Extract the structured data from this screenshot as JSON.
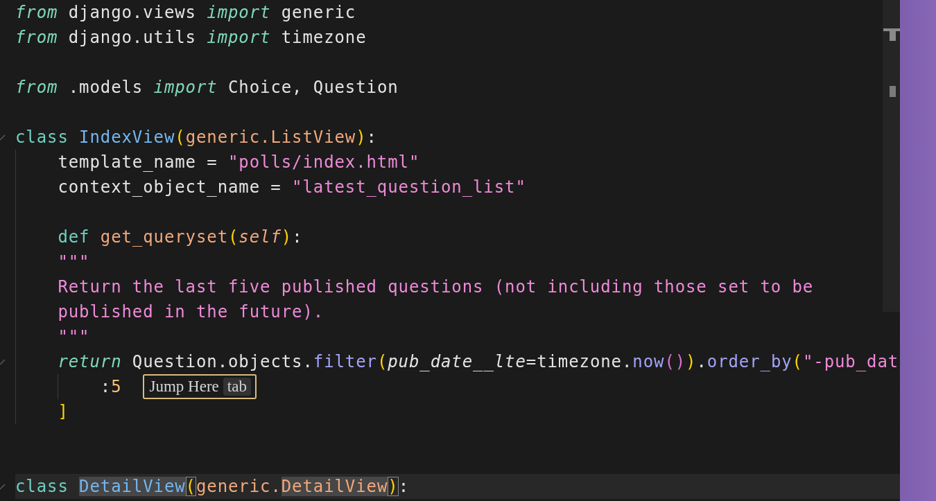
{
  "editor": {
    "lines": [
      {
        "kind": "code",
        "foldable": false,
        "current": false,
        "tokens": [
          {
            "text": "from",
            "kind": "control"
          },
          {
            "text": " django.views ",
            "kind": "plain"
          },
          {
            "text": "import",
            "kind": "control"
          },
          {
            "text": " generic",
            "kind": "plain"
          }
        ]
      },
      {
        "kind": "code",
        "foldable": false,
        "current": false,
        "tokens": [
          {
            "text": "from",
            "kind": "control"
          },
          {
            "text": " django.utils ",
            "kind": "plain"
          },
          {
            "text": "import",
            "kind": "control"
          },
          {
            "text": " timezone",
            "kind": "plain"
          }
        ]
      },
      {
        "kind": "blank"
      },
      {
        "kind": "code",
        "foldable": false,
        "current": false,
        "tokens": [
          {
            "text": "from",
            "kind": "control"
          },
          {
            "text": " .models ",
            "kind": "plain"
          },
          {
            "text": "import",
            "kind": "control"
          },
          {
            "text": " Choice, Question",
            "kind": "plain"
          }
        ]
      },
      {
        "kind": "blank"
      },
      {
        "kind": "code",
        "foldable": true,
        "current": false,
        "tokens": [
          {
            "text": "class ",
            "kind": "keyword"
          },
          {
            "text": "IndexView",
            "kind": "class"
          },
          {
            "text": "(",
            "kind": "bracket"
          },
          {
            "text": "generic.ListView",
            "kind": "base"
          },
          {
            "text": ")",
            "kind": "bracket"
          },
          {
            "text": ":",
            "kind": "plain"
          }
        ],
        "children": [
          {
            "kind": "code",
            "foldable": false,
            "current": false,
            "tokens": [
              {
                "text": "template_name = ",
                "kind": "plain"
              },
              {
                "text": "\"polls/index.html\"",
                "kind": "string"
              }
            ]
          },
          {
            "kind": "code",
            "foldable": false,
            "current": false,
            "tokens": [
              {
                "text": "context_object_name = ",
                "kind": "plain"
              },
              {
                "text": "\"latest_question_list\"",
                "kind": "string"
              }
            ]
          },
          {
            "kind": "blank"
          },
          {
            "kind": "code",
            "foldable": false,
            "current": false,
            "tokens": [
              {
                "text": "def ",
                "kind": "keyword"
              },
              {
                "text": "get_queryset",
                "kind": "base"
              },
              {
                "text": "(",
                "kind": "bracket"
              },
              {
                "text": "self",
                "kind": "param"
              },
              {
                "text": ")",
                "kind": "bracket"
              },
              {
                "text": ":",
                "kind": "plain"
              }
            ]
          },
          {
            "kind": "code",
            "foldable": false,
            "current": false,
            "tokens": [
              {
                "text": "\"\"\"",
                "kind": "string"
              }
            ]
          },
          {
            "kind": "code",
            "foldable": false,
            "current": false,
            "tokens": [
              {
                "text": "Return the last five published questions (not including those set to be",
                "kind": "string"
              }
            ]
          },
          {
            "kind": "code",
            "foldable": false,
            "current": false,
            "tokens": [
              {
                "text": "published in the future).",
                "kind": "string"
              }
            ]
          },
          {
            "kind": "code",
            "foldable": false,
            "current": false,
            "tokens": [
              {
                "text": "\"\"\"",
                "kind": "string"
              }
            ]
          },
          {
            "kind": "code",
            "foldable": true,
            "current": false,
            "tokens": [
              {
                "text": "return",
                "kind": "control"
              },
              {
                "text": " Question.objects.",
                "kind": "plain"
              },
              {
                "text": "filter",
                "kind": "method"
              },
              {
                "text": "(",
                "kind": "bracket"
              },
              {
                "text": "pub_date__lte",
                "kind": "argument"
              },
              {
                "text": "=timezone.",
                "kind": "plain"
              },
              {
                "text": "now",
                "kind": "method"
              },
              {
                "text": "()",
                "kind": "bracket2"
              },
              {
                "text": ")",
                "kind": "bracket"
              },
              {
                "text": ".",
                "kind": "plain"
              },
              {
                "text": "order_by",
                "kind": "method"
              },
              {
                "text": "(",
                "kind": "bracket"
              },
              {
                "text": "\"-pub_dat",
                "kind": "string"
              }
            ],
            "children": [
              {
                "kind": "code",
                "foldable": false,
                "current": false,
                "tokens": [
                  {
                    "text": ":",
                    "kind": "plain"
                  },
                  {
                    "text": "5",
                    "kind": "number"
                  }
                ],
                "hint": {
                  "label": "Jump Here",
                  "key": "tab"
                }
              }
            ]
          },
          {
            "kind": "code",
            "foldable": false,
            "current": false,
            "tokens": [
              {
                "text": "]",
                "kind": "bracket"
              }
            ]
          }
        ]
      },
      {
        "kind": "blank"
      },
      {
        "kind": "blank"
      },
      {
        "kind": "code",
        "foldable": true,
        "current": true,
        "tokens": [
          {
            "text": "class ",
            "kind": "keyword"
          },
          {
            "text": "DetailView",
            "kind": "class",
            "highlighted": true
          },
          {
            "text": "(",
            "kind": "bracket",
            "matched": true
          },
          {
            "text": "generic.",
            "kind": "base"
          },
          {
            "text": "DetailView",
            "kind": "base",
            "highlighted": true
          },
          {
            "text": ")",
            "kind": "bracket",
            "matched": true
          },
          {
            "text": ":",
            "kind": "plain"
          }
        ]
      }
    ]
  }
}
